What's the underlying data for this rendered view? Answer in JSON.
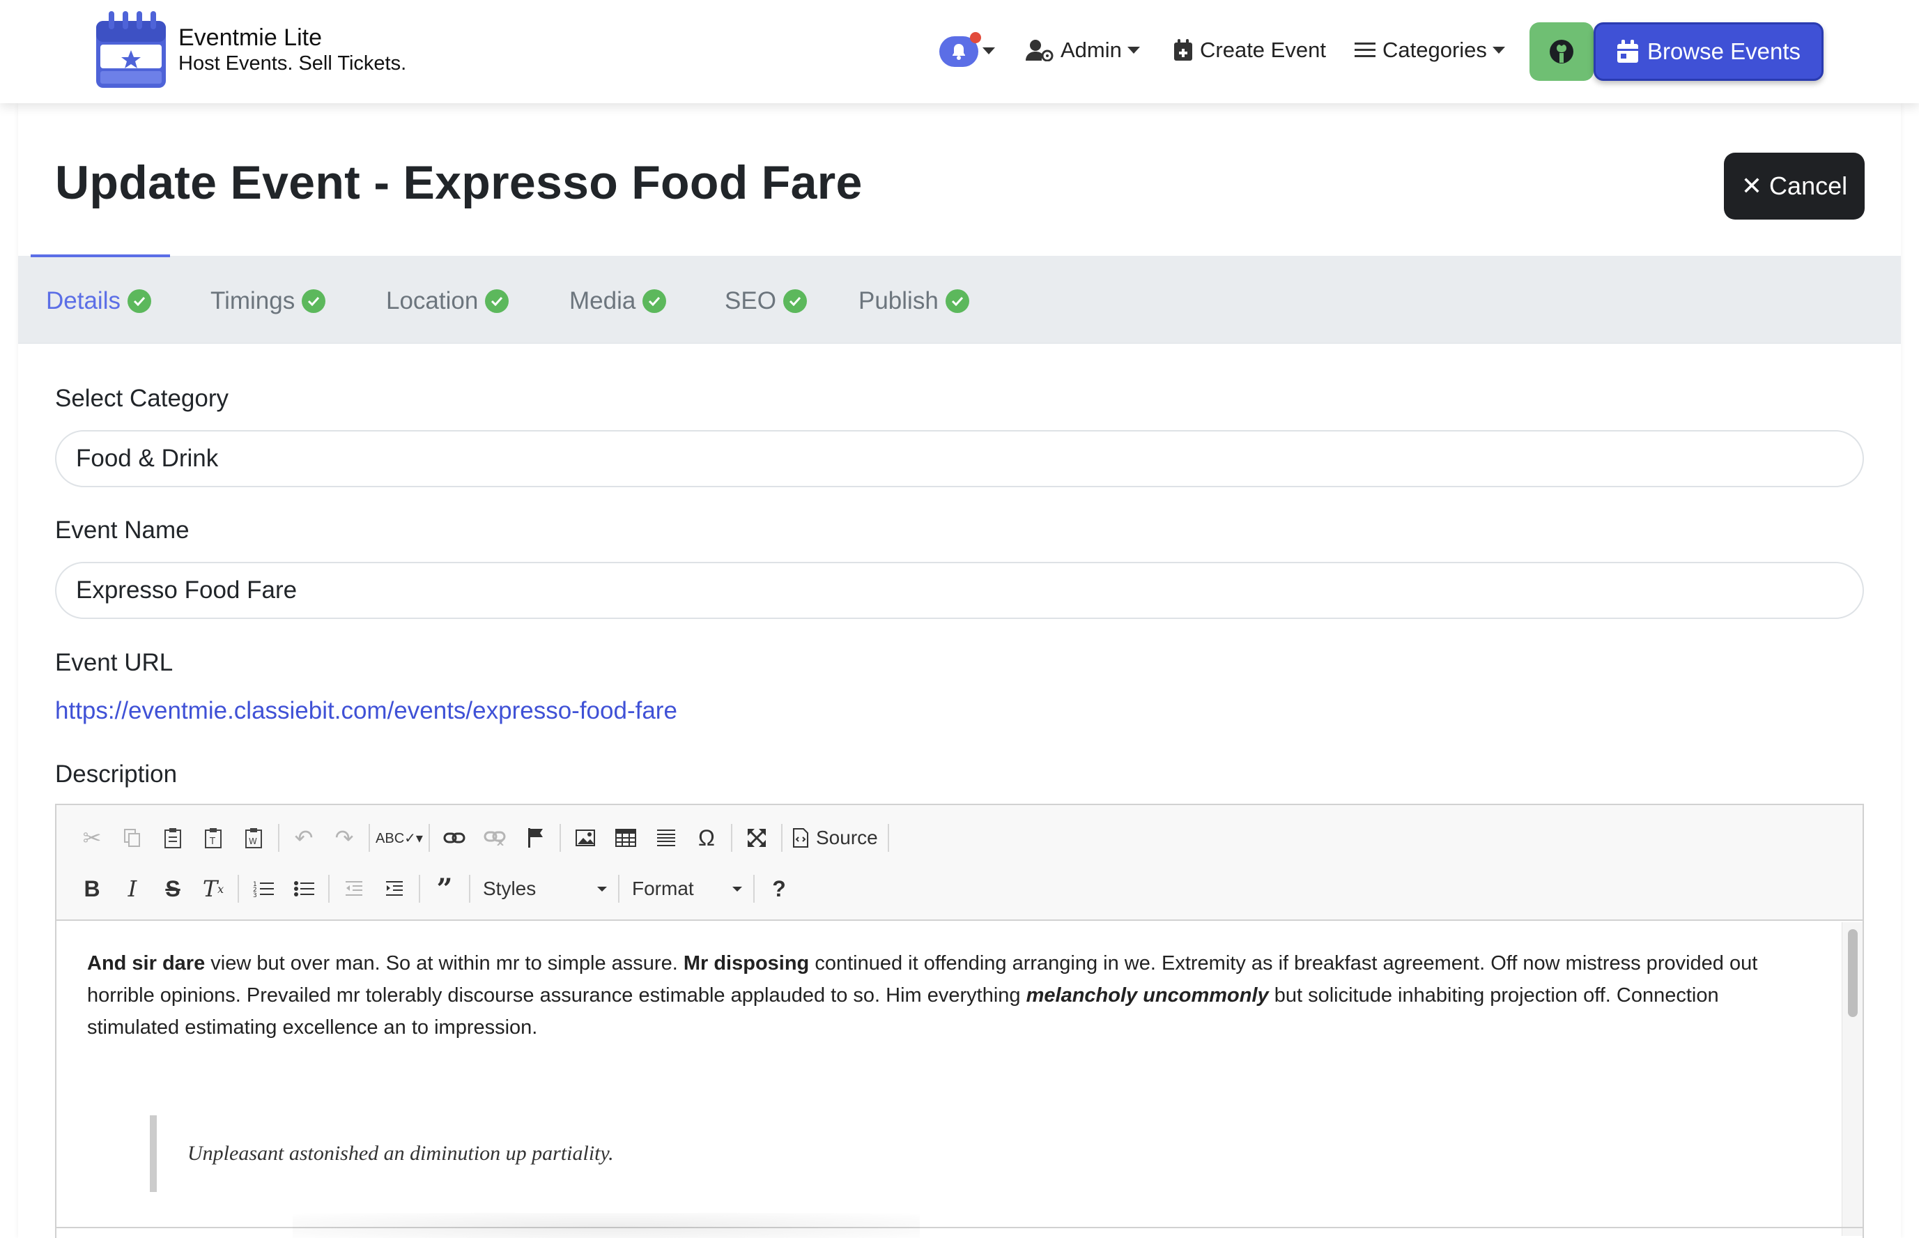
{
  "navbar": {
    "brand_name": "Eventmie Lite",
    "brand_tagline": "Host Events. Sell Tickets.",
    "user_label": "Admin",
    "create_event_label": "Create Event",
    "categories_label": "Categories",
    "browse_events_label": "Browse Events",
    "icons": [
      "bell-icon",
      "user-cog-icon",
      "calendar-plus-icon",
      "bars-icon",
      "github-icon",
      "calendar-icon"
    ]
  },
  "page": {
    "title": "Update Event - Expresso Food Fare",
    "cancel_label": "Cancel"
  },
  "tabs": [
    {
      "label": "Details",
      "active": true,
      "complete": true
    },
    {
      "label": "Timings",
      "active": false,
      "complete": true
    },
    {
      "label": "Location",
      "active": false,
      "complete": true
    },
    {
      "label": "Media",
      "active": false,
      "complete": true
    },
    {
      "label": "SEO",
      "active": false,
      "complete": true
    },
    {
      "label": "Publish",
      "active": false,
      "complete": true
    }
  ],
  "form": {
    "category_label": "Select Category",
    "category_value": "Food & Drink",
    "name_label": "Event Name",
    "name_value": "Expresso Food Fare",
    "url_label": "Event URL",
    "url_value": "https://eventmie.classiebit.com/events/expresso-food-fare",
    "description_label": "Description"
  },
  "editor": {
    "source_label": "Source",
    "styles_label": "Styles",
    "format_label": "Format",
    "content": {
      "p1_bold1": "And sir dare",
      "p1_text1": " view but over man. So at within mr to simple assure. ",
      "p1_bold2": "Mr disposing",
      "p1_text2": " continued it offending arranging in we. Extremity as if breakfast agreement. Off now mistress provided out horrible opinions. Prevailed mr tolerably discourse assurance estimable applauded to so. Him everything ",
      "p1_bolditalic": "melancholy uncommonly",
      "p1_text3": " but solicitude inhabiting projection off. Connection stimulated estimating excellence an to impression.",
      "quote": "Unpleasant astonished an diminution up partiality."
    }
  },
  "colors": {
    "accent": "#5b6ee6",
    "browse_button": "#3f51d6",
    "github_button": "#6fbf73",
    "check": "#5cb85c",
    "cancel_button": "#1f2124"
  }
}
